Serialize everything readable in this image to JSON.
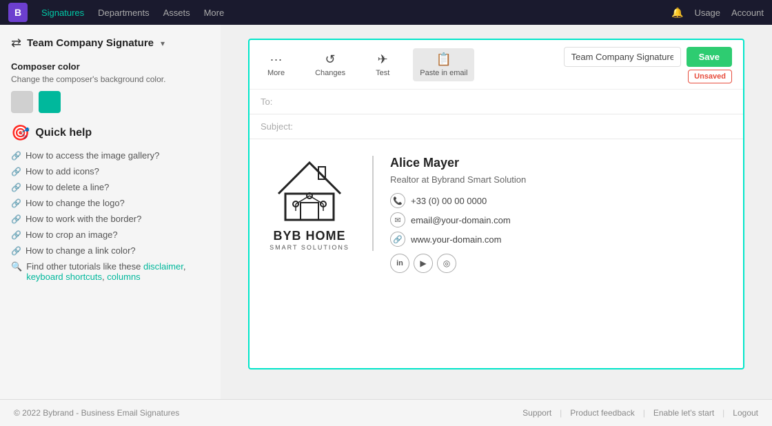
{
  "nav": {
    "logo_text": "B",
    "links": [
      {
        "label": "Signatures",
        "active": true
      },
      {
        "label": "Departments"
      },
      {
        "label": "Assets"
      },
      {
        "label": "More"
      }
    ],
    "right_links": [
      {
        "label": "Usage"
      },
      {
        "label": "Account"
      }
    ]
  },
  "sidebar": {
    "signature_selector": {
      "label": "Team Company Signature",
      "chevron": "▾"
    },
    "composer_color": {
      "title": "Composer color",
      "description": "Change the composer's background color.",
      "swatches": [
        "gray",
        "teal"
      ]
    },
    "quick_help": {
      "title": "Quick help",
      "links": [
        "How to access the image gallery?",
        "How to add icons?",
        "How to delete a line?",
        "How to change the logo?",
        "How to work with the border?",
        "How to crop an image?",
        "How to change a link color?"
      ],
      "tutorials_prefix": "Find other tutorials like these",
      "tutorials_links": [
        "disclaimer",
        "keyboard shortcuts",
        "columns"
      ]
    }
  },
  "toolbar": {
    "more_label": "More",
    "changes_label": "Changes",
    "test_label": "Test",
    "paste_label": "Paste in email",
    "sig_name_value": "Team Company Signature",
    "save_label": "Save",
    "unsaved_label": "Unsaved"
  },
  "email": {
    "to_placeholder": "To:",
    "subject_placeholder": "Subject:"
  },
  "signature": {
    "brand_name": "BYB HOME",
    "brand_sub": "SMART SOLUTIONS",
    "person_name": "Alice Mayer",
    "person_title": "Realtor at Bybrand Smart Solution",
    "phone": "+33 (0) 00 00 0000",
    "email": "email@your-domain.com",
    "website": "www.your-domain.com",
    "social": [
      "in",
      "▶",
      "◎"
    ]
  },
  "footer": {
    "copyright": "© 2022 Bybrand - Business Email Signatures",
    "links": [
      "Support",
      "Product feedback",
      "Enable let's start",
      "Logout"
    ]
  }
}
